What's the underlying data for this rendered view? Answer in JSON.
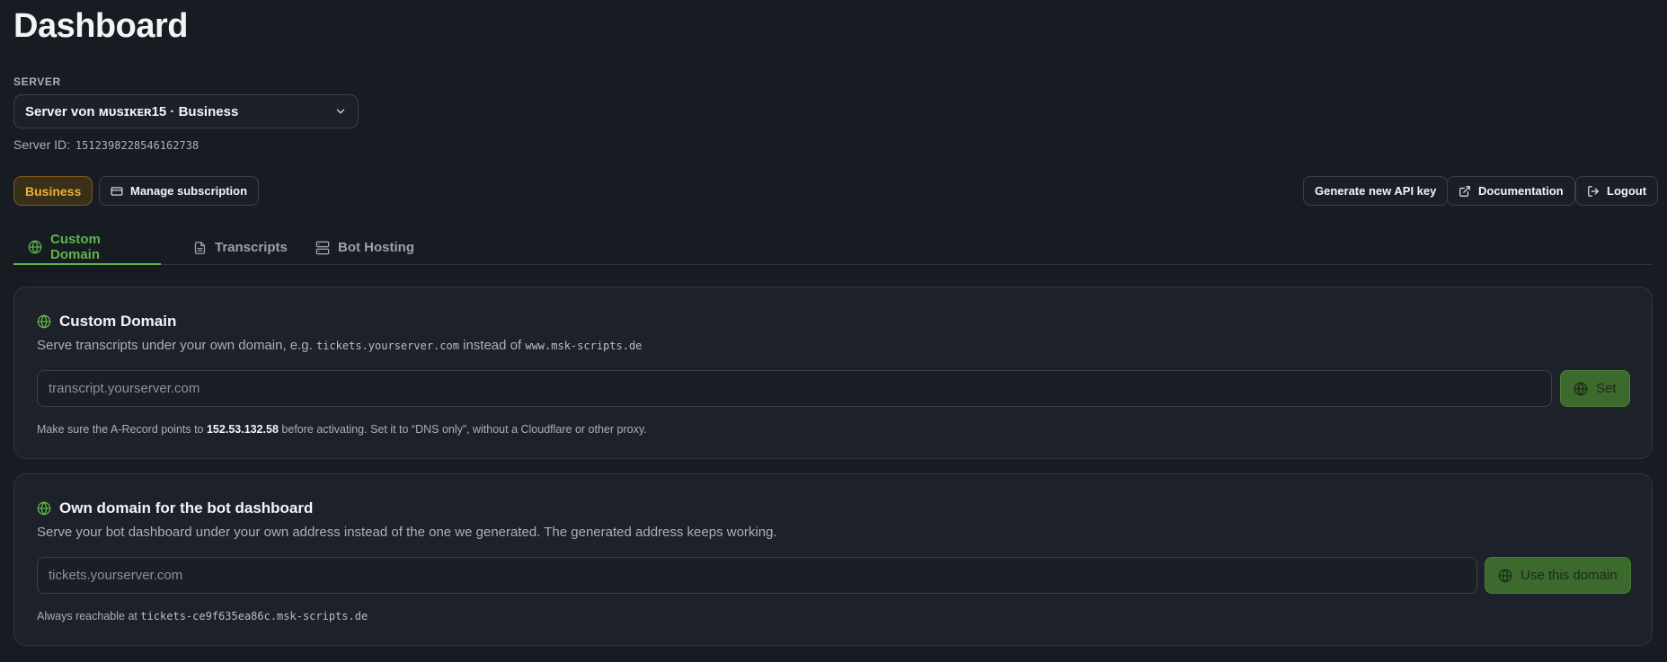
{
  "page": {
    "title": "Dashboard"
  },
  "server": {
    "label": "SERVER",
    "selected": "Server von ᴍᴜsɪᴋᴇʀ15 · Business",
    "id_label": "Server ID:",
    "id_value": "1512398228546162738"
  },
  "toolbar": {
    "plan_badge": "Business",
    "manage_subscription": "Manage subscription",
    "generate_api_key": "Generate new API key",
    "documentation": "Documentation",
    "logout": "Logout"
  },
  "tabs": [
    {
      "label": "Custom Domain",
      "icon": "globe-icon",
      "active": true
    },
    {
      "label": "Transcripts",
      "icon": "file-icon",
      "active": false
    },
    {
      "label": "Bot Hosting",
      "icon": "server-icon",
      "active": false
    }
  ],
  "custom_domain": {
    "title": "Custom Domain",
    "desc_prefix": "Serve transcripts under your own domain, e.g. ",
    "desc_example": "tickets.yourserver.com",
    "desc_middle": " instead of ",
    "desc_default": "www.msk-scripts.de",
    "placeholder": "transcript.yourserver.com",
    "button": "Set",
    "note_prefix": "Make sure the A-Record points to ",
    "note_ip": "152.53.132.58",
    "note_suffix": " before activating. Set it to “DNS only”, without a Cloudflare or other proxy."
  },
  "bot_domain": {
    "title": "Own domain for the bot dashboard",
    "desc": "Serve your bot dashboard under your own address instead of the one we generated. The generated address keeps working.",
    "placeholder": "tickets.yourserver.com",
    "button": "Use this domain",
    "note_prefix": "Always reachable at ",
    "note_address": "tickets-ce9f635ea86c.msk-scripts.de"
  },
  "colors": {
    "background": "#171b22",
    "accent_green": "#5fb548",
    "badge_gold": "#e9b236"
  }
}
